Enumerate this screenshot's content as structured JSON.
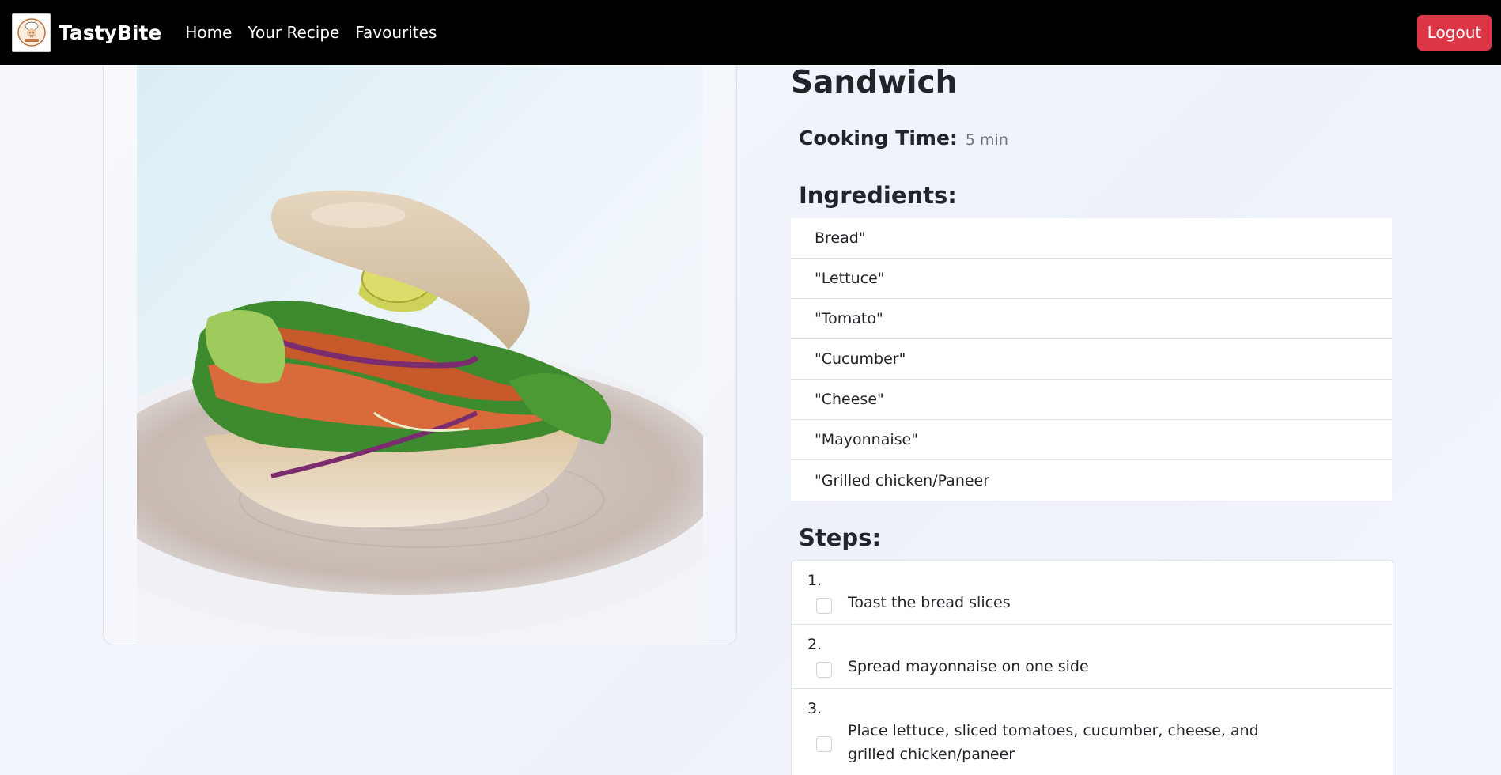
{
  "navbar": {
    "brand": "TastyBite",
    "links": [
      "Home",
      "Your Recipe",
      "Favourites"
    ],
    "logout_label": "Logout"
  },
  "recipe": {
    "title": "Sandwich",
    "cooking_time_label": "Cooking Time:",
    "cooking_time_value": "5 min",
    "ingredients_heading": "Ingredients:",
    "ingredients": [
      "Bread\"",
      "\"Lettuce\"",
      "\"Tomato\"",
      "\"Cucumber\"",
      "\"Cheese\"",
      "\"Mayonnaise\"",
      "\"Grilled chicken/Paneer"
    ],
    "steps_heading": "Steps:",
    "steps": [
      {
        "number": "1.",
        "text": "Toast the bread slices"
      },
      {
        "number": "2.",
        "text": "Spread mayonnaise on one side"
      },
      {
        "number": "3.",
        "text": "Place lettuce, sliced tomatoes, cucumber, cheese, and grilled chicken/paneer"
      }
    ]
  },
  "colors": {
    "navbar_bg": "#000000",
    "logout_bg": "#dc3545"
  }
}
